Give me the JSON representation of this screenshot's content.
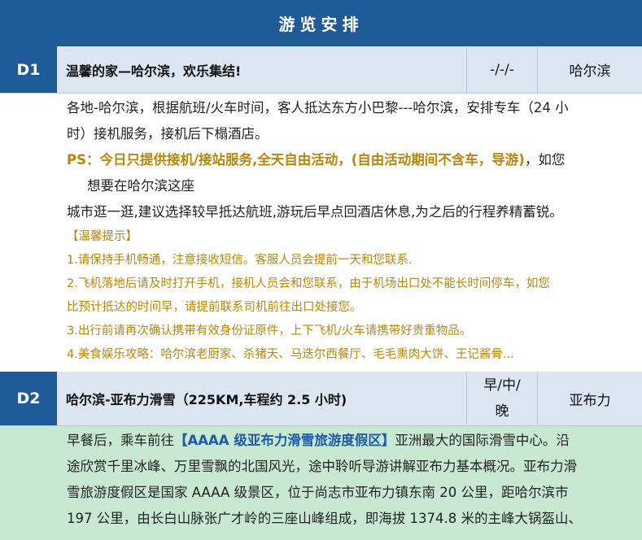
{
  "header": {
    "title": "游览安排"
  },
  "days": [
    {
      "day": "D1",
      "title": "温馨的家—哈尔滨，欢乐集结!",
      "meals": "-/-/-",
      "city": "哈尔滨",
      "line1": "各地-哈尔滨，根据航班/火车时间，客人抵达东方小巴黎---哈尔滨，安排专车（24 小",
      "line2": "时）接机服务，接机后下榻酒店。",
      "ps_bold": "PS：今日只提供接机/接站服务,全天自由活动，(自由活动期间不含车，导游)",
      "ps_rest": "，如您",
      "ps_cont": "想要在哈尔滨这座",
      "line3": "城市逛一逛,建议选择较早抵达航班,游玩后早点回酒店休息,为之后的行程养精蓄锐。",
      "tips": [
        "【温馨提示】",
        "1.请保持手机畅通，注意接收短信。客服人员会提前一天和您联系.",
        "2.飞机落地后请及时打开手机，接机人员会和您联系，由于机场出口处不能长时间停车，如您",
        "比预计抵达的时间早，请提前联系司机前往出口处接您。",
        "3.出行前请再次确认携带有效身份证原件，上下飞机/火车请携带好贵重物品。",
        "4.美食娱乐攻略：哈尔滨老厨家、杀猪天、马迭尔西餐厅、毛毛熏肉大饼、王记酱骨..."
      ]
    },
    {
      "day": "D2",
      "title": "哈尔滨-亚布力滑雪（225KM,车程约 2.5 小时)",
      "meals_line1": "早/中/",
      "meals_line2": "晚",
      "city": "亚布力",
      "p1_pre": "早餐后，乘车前往",
      "p1_hl": "【AAAA 级亚布力滑雪旅游度假区】",
      "p1_post": "亚洲最大的国际滑雪中心。沿",
      "line2": "途欣赏千里冰峰、万里雪飘的北国风光，途中聆听导游讲解亚布力基本概况。亚布力滑",
      "line3": "雪旅游度假区是国家 AAAA 级景区，位于尚志市亚布力镇东南 20 公里，距哈尔滨市",
      "line4": "197 公里，由长白山脉张广才岭的三座山峰组成，即海拔 1374.8 米的主峰大锅盔山、"
    }
  ]
}
